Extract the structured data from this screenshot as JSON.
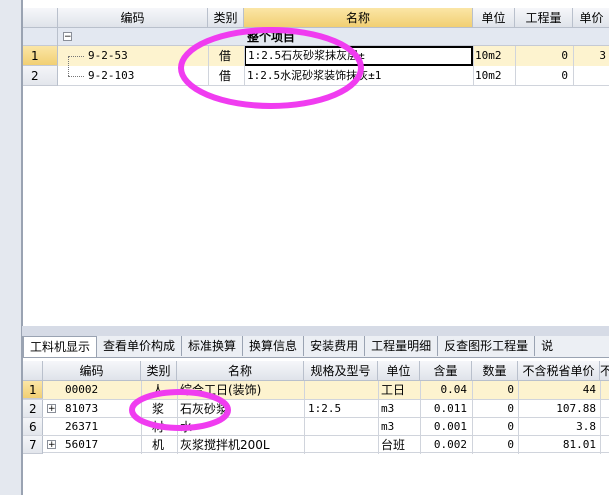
{
  "top_grid": {
    "columns": [
      "编码",
      "类别",
      "名称",
      "单位",
      "工程量",
      "单价"
    ],
    "group_row": {
      "toggle": "−",
      "name": "整个项目"
    },
    "rows": [
      {
        "num": "1",
        "code": "9-2-53",
        "type": "借",
        "name": "1:2.5石灰砂浆抹灰层±",
        "unit": "10m2",
        "qty": "0",
        "price": "3"
      },
      {
        "num": "2",
        "code": "9-2-103",
        "type": "借",
        "name": "1:2.5水泥砂浆装饰抹灰±1",
        "unit": "10m2",
        "qty": "0",
        "price": ""
      }
    ]
  },
  "tabs": [
    "工料机显示",
    "查看单价构成",
    "标准换算",
    "换算信息",
    "安装费用",
    "工程量明细",
    "反查图形工程量",
    "说"
  ],
  "bottom_grid": {
    "columns": [
      "编码",
      "类别",
      "名称",
      "规格及型号",
      "单位",
      "含量",
      "数量",
      "不含税省单价",
      "不含税"
    ],
    "rows": [
      {
        "num": "1",
        "expand": "",
        "code": "00002",
        "type": "人",
        "name": "综合工日(装饰)",
        "spec": "",
        "unit": "工日",
        "content": "0.04",
        "qty": "0",
        "price": "44"
      },
      {
        "num": "2",
        "expand": "+",
        "code": "81073",
        "type": "浆",
        "name": "石灰砂浆",
        "spec": "1:2.5",
        "unit": "m3",
        "content": "0.011",
        "qty": "0",
        "price": "107.88"
      },
      {
        "num": "6",
        "expand": "",
        "code": "26371",
        "type": "材",
        "name": "水",
        "spec": "",
        "unit": "m3",
        "content": "0.001",
        "qty": "0",
        "price": "3.8"
      },
      {
        "num": "7",
        "expand": "+",
        "code": "56017",
        "type": "机",
        "name": "灰浆搅拌机200L",
        "spec": "",
        "unit": "台班",
        "content": "0.002",
        "qty": "0",
        "price": "81.01"
      }
    ]
  },
  "colors": {
    "highlight_row": "#fdf3cf",
    "selected_header": "#f6d98a",
    "annotation": "#f03cf0",
    "tab_active": "#ffffff"
  }
}
